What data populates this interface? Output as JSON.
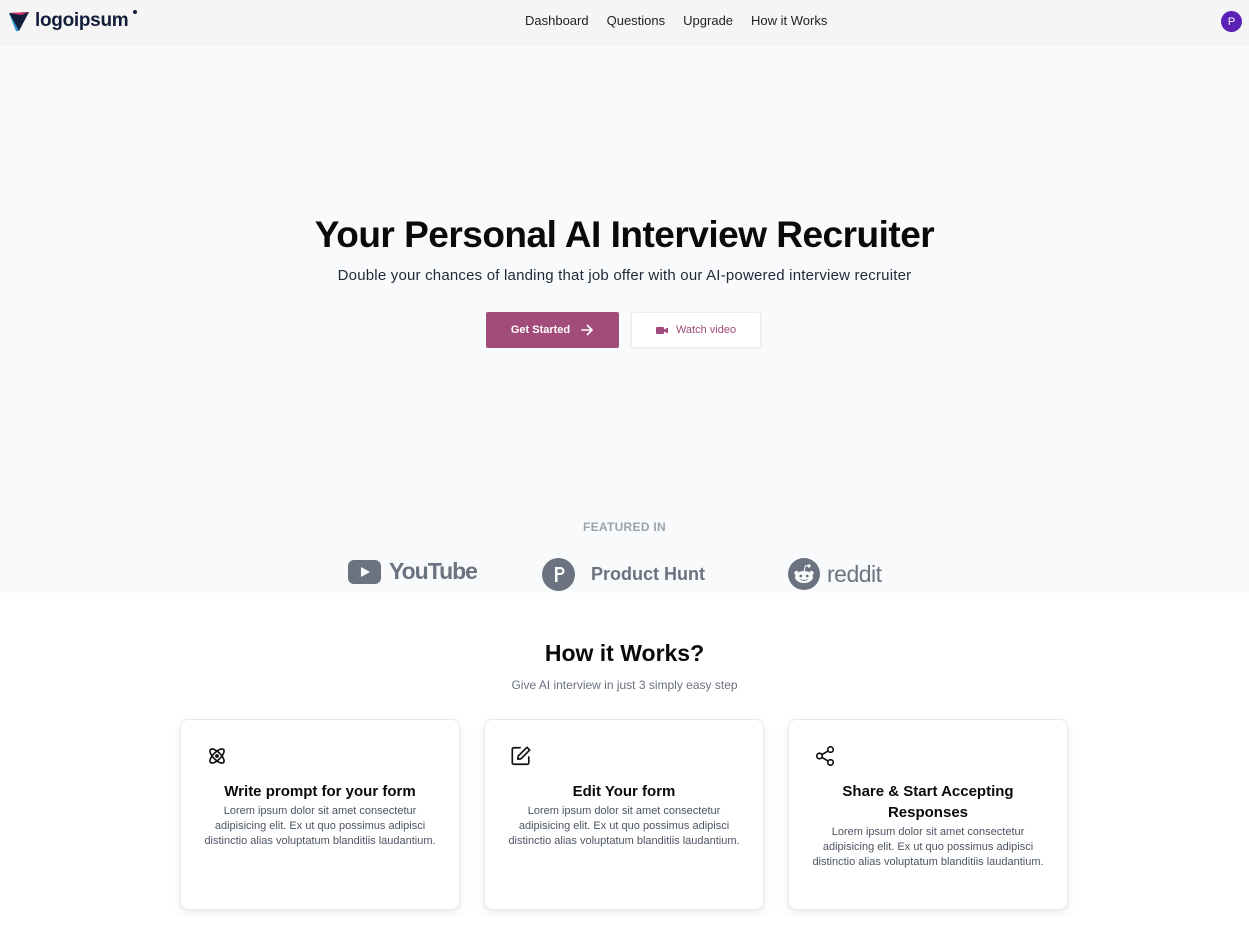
{
  "brand": {
    "logo_text": "logoipsum"
  },
  "nav": {
    "items": [
      {
        "label": "Dashboard"
      },
      {
        "label": "Questions"
      },
      {
        "label": "Upgrade"
      },
      {
        "label": "How it Works"
      }
    ],
    "avatar_initial": "P"
  },
  "hero": {
    "title": "Your Personal AI Interview Recruiter",
    "subtitle": "Double your chances of landing that job offer with our AI-powered interview recruiter",
    "primary_cta": "Get Started",
    "secondary_cta": "Watch video"
  },
  "featured": {
    "label": "FEATURED IN",
    "brands": [
      {
        "name": "YouTube",
        "icon": "youtube-icon"
      },
      {
        "name": "Product Hunt",
        "icon": "product-hunt-icon"
      },
      {
        "name": "reddit",
        "icon": "reddit-icon"
      }
    ]
  },
  "how_it_works": {
    "title": "How it Works?",
    "subtitle": "Give AI interview in just 3 simply easy step",
    "cards": [
      {
        "icon": "atom-icon",
        "title": "Write prompt for your form",
        "text": "Lorem ipsum dolor sit amet consectetur adipisicing elit. Ex ut quo possimus adipisci distinctio alias voluptatum blanditiis laudantium."
      },
      {
        "icon": "edit-icon",
        "title": "Edit Your form",
        "text": "Lorem ipsum dolor sit amet consectetur adipisicing elit. Ex ut quo possimus adipisci distinctio alias voluptatum blanditiis laudantium."
      },
      {
        "icon": "share-icon",
        "title": "Share & Start Accepting Responses",
        "text": "Lorem ipsum dolor sit amet consectetur adipisicing elit. Ex ut quo possimus adipisci distinctio alias voluptatum blanditiis laudantium."
      }
    ]
  },
  "colors": {
    "accent": "#a14c7a",
    "avatar": "#5b21b6",
    "hero_bg": "#f9fafb",
    "navbar_bg": "#f5f5f5"
  }
}
